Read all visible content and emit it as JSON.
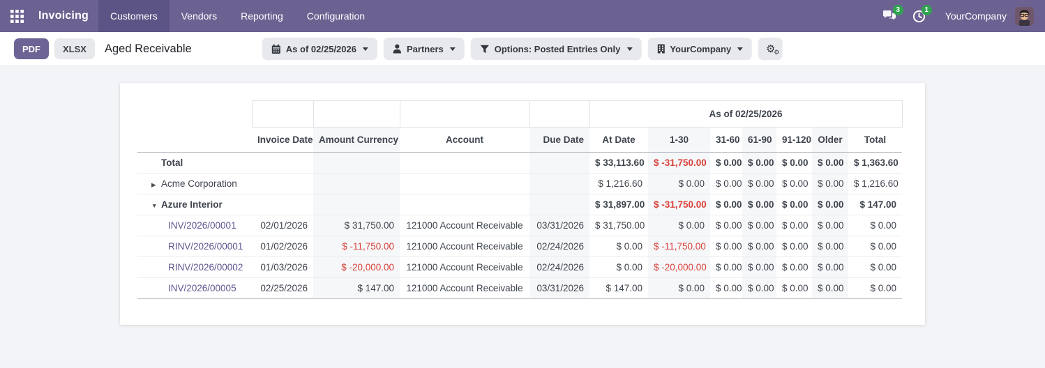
{
  "navbar": {
    "app_name": "Invoicing",
    "menus": [
      "Customers",
      "Vendors",
      "Reporting",
      "Configuration"
    ],
    "active_menu": "Customers",
    "messages_badge": "3",
    "activities_badge": "1",
    "company": "YourCompany"
  },
  "toolbar": {
    "pdf_label": "PDF",
    "xlsx_label": "XLSX",
    "title": "Aged Receivable",
    "filters": {
      "date": "As of 02/25/2026",
      "partners": "Partners",
      "options": "Options: Posted Entries Only",
      "company": "YourCompany"
    }
  },
  "icons": {
    "apps": "grid-icon",
    "messages": "chat-bubbles-icon",
    "activities": "clock-icon",
    "date_filter": "calendar-icon",
    "partners_filter": "user-icon",
    "options_filter": "funnel-icon",
    "company_filter": "building-icon",
    "settings": "cogs-icon",
    "collapsed_row": "caret-right-icon",
    "expanded_row": "caret-down-icon"
  },
  "table": {
    "period_header": "As of 02/25/2026",
    "columns": [
      "",
      "Invoice Date",
      "Amount Currency",
      "Account",
      "Due Date",
      "At Date",
      "1-30",
      "31-60",
      "61-90",
      "91-120",
      "Older",
      "Total"
    ],
    "rows": [
      {
        "type": "total",
        "name": "Total",
        "bold": true,
        "expanded": null,
        "cells": [
          "",
          "",
          "",
          "",
          "$ 33,113.60",
          "$ -31,750.00",
          "$ 0.00",
          "$ 0.00",
          "$ 0.00",
          "$ 0.00",
          "$ 1,363.60"
        ]
      },
      {
        "type": "partner",
        "name": "Acme Corporation",
        "bold": false,
        "expanded": false,
        "cells": [
          "",
          "",
          "",
          "",
          "$ 1,216.60",
          "$ 0.00",
          "$ 0.00",
          "$ 0.00",
          "$ 0.00",
          "$ 0.00",
          "$ 1,216.60"
        ]
      },
      {
        "type": "partner",
        "name": "Azure Interior",
        "bold": true,
        "expanded": true,
        "cells": [
          "",
          "",
          "",
          "",
          "$ 31,897.00",
          "$ -31,750.00",
          "$ 0.00",
          "$ 0.00",
          "$ 0.00",
          "$ 0.00",
          "$ 147.00"
        ]
      },
      {
        "type": "line",
        "name": "INV/2026/00001",
        "bold": false,
        "expanded": null,
        "cells": [
          "02/01/2026",
          "$ 31,750.00",
          "121000 Account Receivable",
          "03/31/2026",
          "$ 31,750.00",
          "$ 0.00",
          "$ 0.00",
          "$ 0.00",
          "$ 0.00",
          "$ 0.00",
          "$ 0.00"
        ]
      },
      {
        "type": "line",
        "name": "RINV/2026/00001",
        "bold": false,
        "expanded": null,
        "cells": [
          "01/02/2026",
          "$ -11,750.00",
          "121000 Account Receivable",
          "02/24/2026",
          "$ 0.00",
          "$ -11,750.00",
          "$ 0.00",
          "$ 0.00",
          "$ 0.00",
          "$ 0.00",
          "$ 0.00"
        ]
      },
      {
        "type": "line",
        "name": "RINV/2026/00002",
        "bold": false,
        "expanded": null,
        "cells": [
          "01/03/2026",
          "$ -20,000.00",
          "121000 Account Receivable",
          "02/24/2026",
          "$ 0.00",
          "$ -20,000.00",
          "$ 0.00",
          "$ 0.00",
          "$ 0.00",
          "$ 0.00",
          "$ 0.00"
        ]
      },
      {
        "type": "line",
        "name": "INV/2026/00005",
        "bold": false,
        "expanded": null,
        "cells": [
          "02/25/2026",
          "$ 147.00",
          "121000 Account Receivable",
          "03/31/2026",
          "$ 147.00",
          "$ 0.00",
          "$ 0.00",
          "$ 0.00",
          "$ 0.00",
          "$ 0.00",
          "$ 0.00"
        ]
      }
    ]
  },
  "colors": {
    "navbar_purple": "#6C6292",
    "navbar_active": "#5D5486",
    "accent_purple": "#6D6394",
    "link_purple": "#5D5490",
    "negative_red": "#D94039",
    "badge_green": "#2FA44F",
    "column_stripe": "#F6F7F9"
  }
}
